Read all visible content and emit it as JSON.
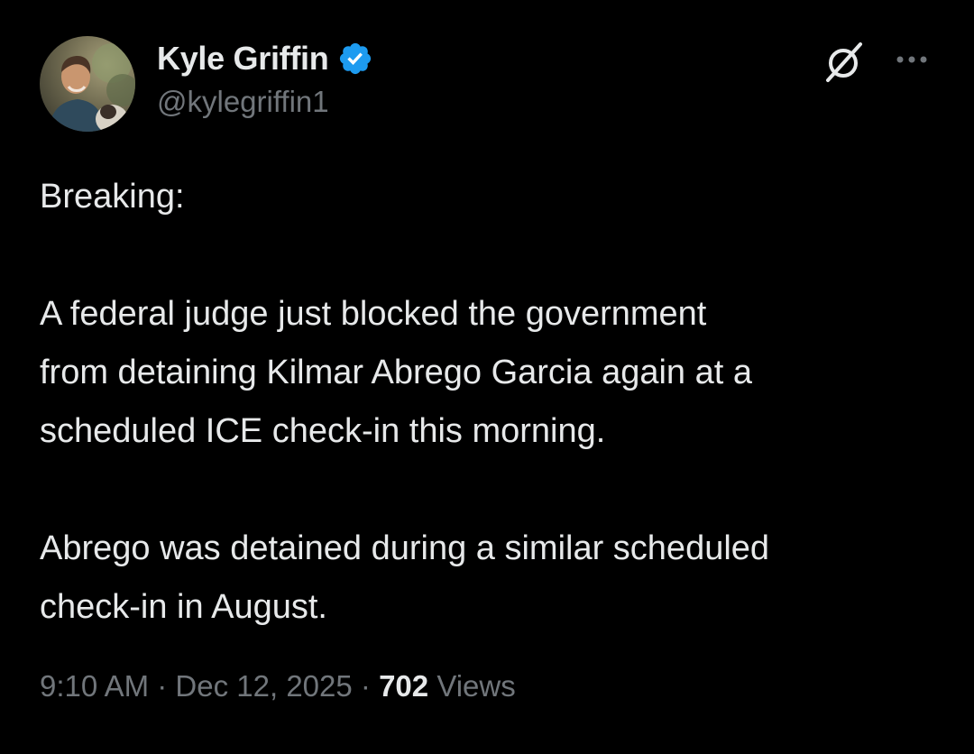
{
  "author": {
    "display_name": "Kyle Griffin",
    "handle": "@kylegriffin1",
    "verified": true,
    "avatar_icon": "profile-photo"
  },
  "actions": {
    "grok_icon": "grok-icon",
    "more_icon": "more-options-icon"
  },
  "tweet": {
    "paragraphs": [
      "Breaking:",
      "A federal judge just blocked the government\nfrom detaining Kilmar Abrego Garcia again at a\nscheduled ICE check-in this morning.",
      "Abrego was detained during a similar scheduled\ncheck-in in August."
    ]
  },
  "meta": {
    "time": "9:10 AM",
    "date": "Dec 12, 2025",
    "separator": "·",
    "views_count": "702",
    "views_label": "Views"
  },
  "colors": {
    "background": "#000000",
    "text_primary": "#e7e9ea",
    "text_secondary": "#71767b",
    "verified_badge": "#1d9bf0"
  }
}
